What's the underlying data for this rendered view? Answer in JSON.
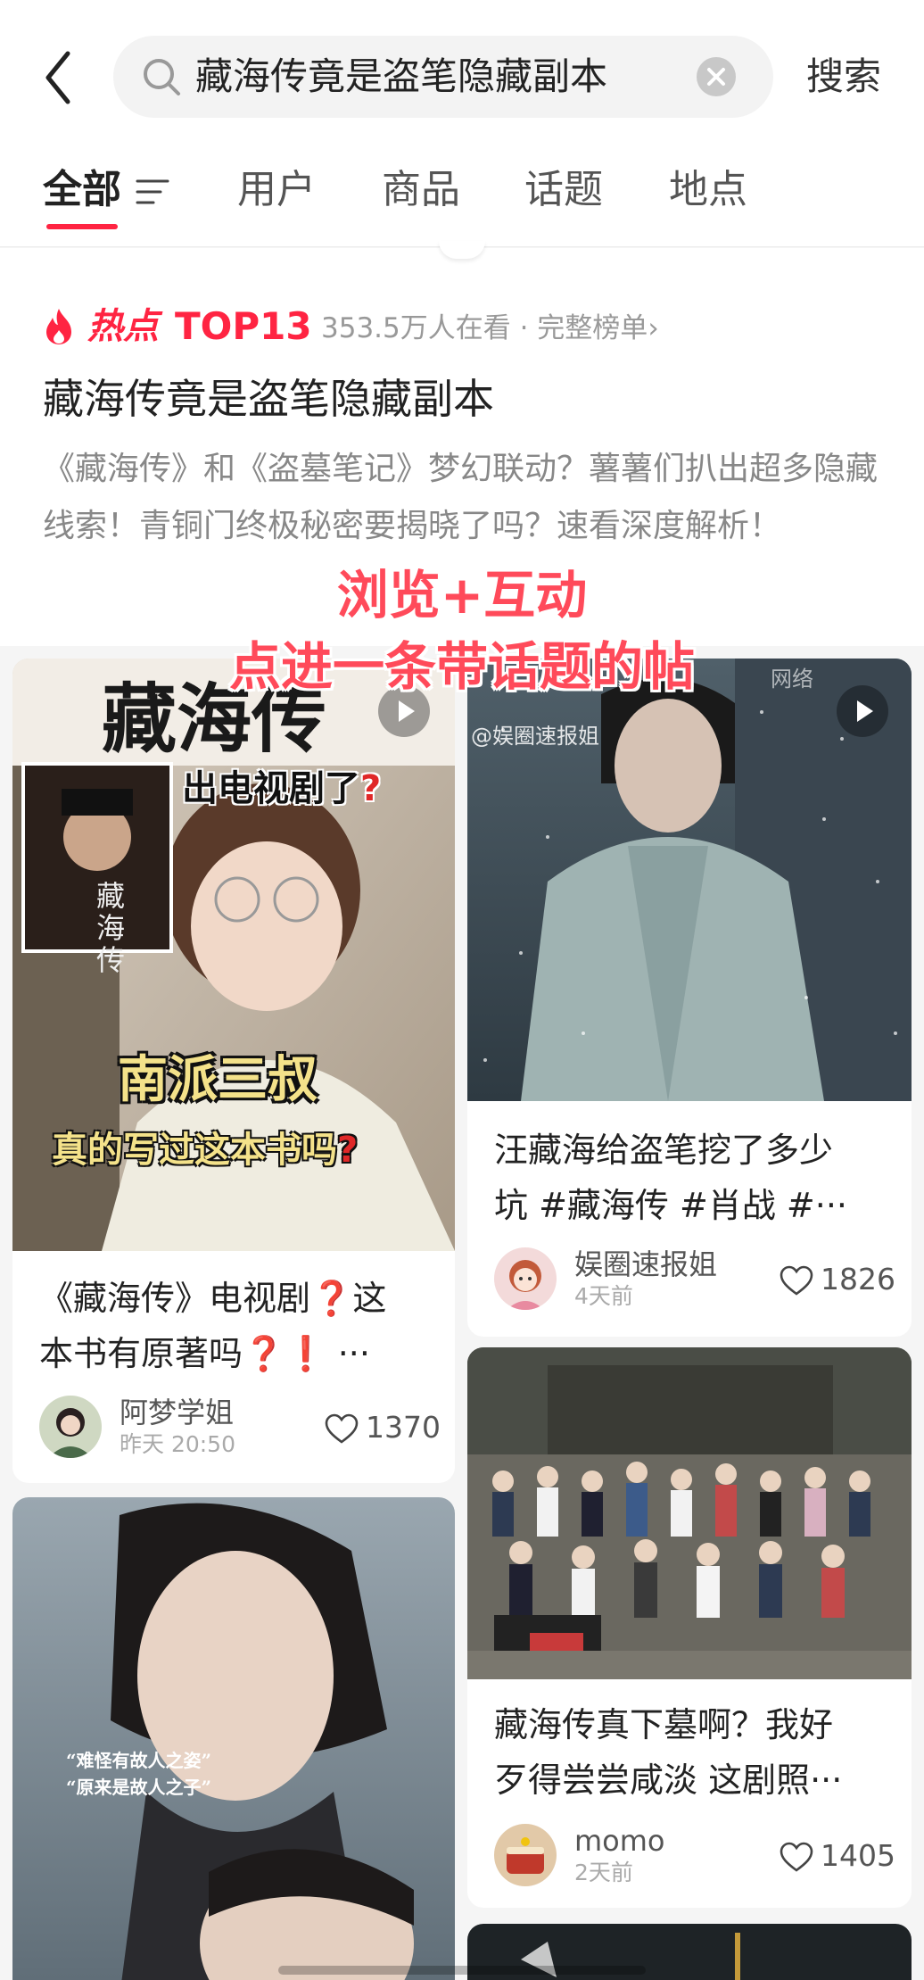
{
  "search": {
    "query": "藏海传竟是盗笔隐藏副本",
    "button_label": "搜索"
  },
  "tabs": [
    {
      "label": "全部",
      "active": true
    },
    {
      "label": "用户",
      "active": false
    },
    {
      "label": "商品",
      "active": false
    },
    {
      "label": "话题",
      "active": false
    },
    {
      "label": "地点",
      "active": false
    }
  ],
  "hot_topic": {
    "hot_label": "热点",
    "rank_label": "TOP13",
    "meta": "353.5万人在看 · 完整榜单",
    "meta_chevron": "›",
    "title": "藏海传竟是盗笔隐藏副本",
    "description": "《藏海传》和《盗墓笔记》梦幻联动？薯薯们扒出超多隐藏线索！青铜门终极秘密要揭晓了吗？速看深度解析！"
  },
  "overlay_annotation": {
    "line1": "浏览+互动",
    "line2": "点进一条带话题的帖"
  },
  "feed": {
    "left": [
      {
        "thumb_text": {
          "title": "藏海传",
          "sub1": "出电视剧了",
          "sub2": "南派三叔",
          "sub3": "真的写过这本书吗",
          "poster_text": "藏海传"
        },
        "is_video": true,
        "title_line1": "《藏海传》电视剧❓这",
        "title_line2": "本书有原著吗❓❗ ···",
        "author": "阿梦学姐",
        "time": "昨天 20:50",
        "likes": "1370"
      },
      {
        "thumb_text": {
          "quote1": "“难怪有故人之姿”",
          "quote2": "“原来是故人之子”"
        },
        "is_video": false
      }
    ],
    "right": [
      {
        "thumb_text": {
          "watermark": "@娱圈速报姐",
          "corner": "网络"
        },
        "is_video": true,
        "title_line1": "汪藏海给盗笔挖了多少",
        "title_line2": "坑 #藏海传 #肖战 #···",
        "author": "娱圈速报姐",
        "time": "4天前",
        "likes": "1826"
      },
      {
        "is_video": false,
        "title_line1": "藏海传真下墓啊？我好",
        "title_line2": "歹得尝尝咸淡 这剧照···",
        "author": "momo",
        "time": "2天前",
        "likes": "1405"
      }
    ]
  },
  "colors": {
    "accent": "#ff2442",
    "overlay_text": "#ff4a5a",
    "background": "#f5f5f5"
  },
  "icons": [
    "back-arrow-icon",
    "search-icon",
    "clear-icon",
    "filter-icon",
    "fire-icon",
    "play-icon",
    "heart-icon"
  ]
}
